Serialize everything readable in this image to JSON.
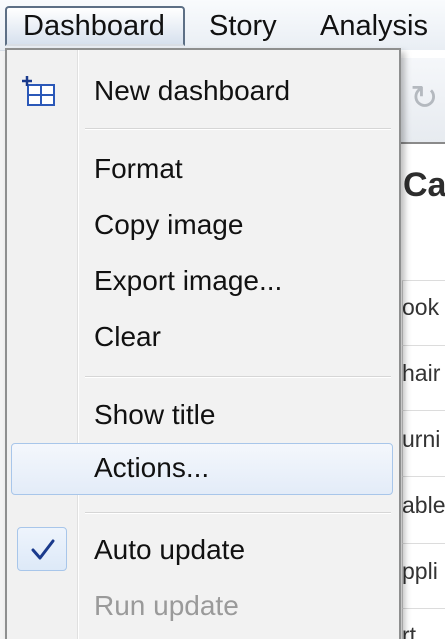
{
  "menubar": {
    "items": [
      {
        "label": "Dashboard"
      },
      {
        "label": "Story"
      },
      {
        "label": "Analysis"
      }
    ]
  },
  "background": {
    "heading": "Ca",
    "rows": [
      "ook",
      "hair",
      "urni",
      "able",
      "ppli",
      "rt"
    ]
  },
  "dashboard_menu": {
    "new_dashboard": {
      "label": "New dashboard",
      "icon": "new-dashboard-icon"
    },
    "format": {
      "label": "Format"
    },
    "copy_image": {
      "label": "Copy image"
    },
    "export_image": {
      "label": "Export image..."
    },
    "clear": {
      "label": "Clear"
    },
    "show_title": {
      "label": "Show title"
    },
    "actions": {
      "label": "Actions...",
      "state": "hovered"
    },
    "auto_update": {
      "label": "Auto update",
      "checked": true,
      "icon": "checkmark-icon"
    },
    "run_update": {
      "label": "Run update",
      "enabled": false
    }
  },
  "colors": {
    "highlight_border": "#a8c6ea",
    "check": "#1a3a8c",
    "icon_blue": "#2b58b8"
  }
}
